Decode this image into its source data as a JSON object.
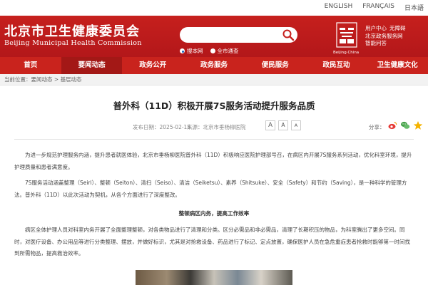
{
  "languages": [
    "ENGLISH",
    "FRANÇAIS",
    "日本語"
  ],
  "header": {
    "title_cn": "北京市卫生健康委员会",
    "title_en": "Beijing Municipal Health Commission",
    "search": {
      "placeholder": "",
      "scopes": [
        "搜本网",
        "全市通查"
      ],
      "selected_scope": "搜本网"
    },
    "emblem_caption": "Beijing·China",
    "quick_links": [
      [
        "用户中心",
        "无障碍"
      ],
      [
        "北京政务服务网"
      ],
      [
        "智能问答"
      ]
    ]
  },
  "nav": {
    "items": [
      "首页",
      "要闻动态",
      "政务公开",
      "政务服务",
      "便民服务",
      "政民互动",
      "卫生健康文化"
    ],
    "active": "要闻动态"
  },
  "breadcrumb": {
    "prefix": "当前位置：",
    "items": [
      "要闻动态",
      "基层动态"
    ],
    "separator": " > "
  },
  "article": {
    "title": "普外科（11D）积极开展7S服务活动提升服务品质",
    "date_label": "发布日期：",
    "date": "2025-02-15",
    "source_label": "来源：",
    "source": "北京市垂杨柳医院",
    "font_buttons": [
      "A",
      "A",
      "A"
    ],
    "share_label": "分享：",
    "share_icons": [
      "weibo-icon",
      "wechat-icon",
      "star-icon"
    ],
    "paragraphs": [
      "为进一步规范护理服务内涵，提升患者就医体验，北京市垂杨柳医院普外科（11D）积极响应医院护理部号召，在病区内开展7S服务系列活动，优化科室环境，提升护理质量和患者满意度。",
      "7S服务活动涵盖整理（Seiri）、整顿（Seiton）、清扫（Seiso）、清洁（Seiketsu）、素养（Shitsuke）、安全（Safety）和节约（Saving），是一种科学的管理方法。普外科（11D）以此次活动为契机，从各个方面进行了深度整改。"
    ],
    "subheading": "整顿病区内务，提高工作效率",
    "paragraph3": "病区全体护理人员对科室内务开展了全面整理整顿，对各类物品进行了清理和分类。区分必需品和非必需品，清理了长期积压的物品，为科室腾出了更多空间。同时，对医疗设备、办公用品等进行分类整理、摆放，并做好标识，尤其是对抢救设备、药品进行了标记、定点放置，确保医护人员在急危重症患者抢救时能够第一时间找到所需物品，提高救治效率。"
  },
  "colors": {
    "brand_red": "#c6201d",
    "nav_active": "#a31816",
    "link_blue": "#1565c0"
  }
}
